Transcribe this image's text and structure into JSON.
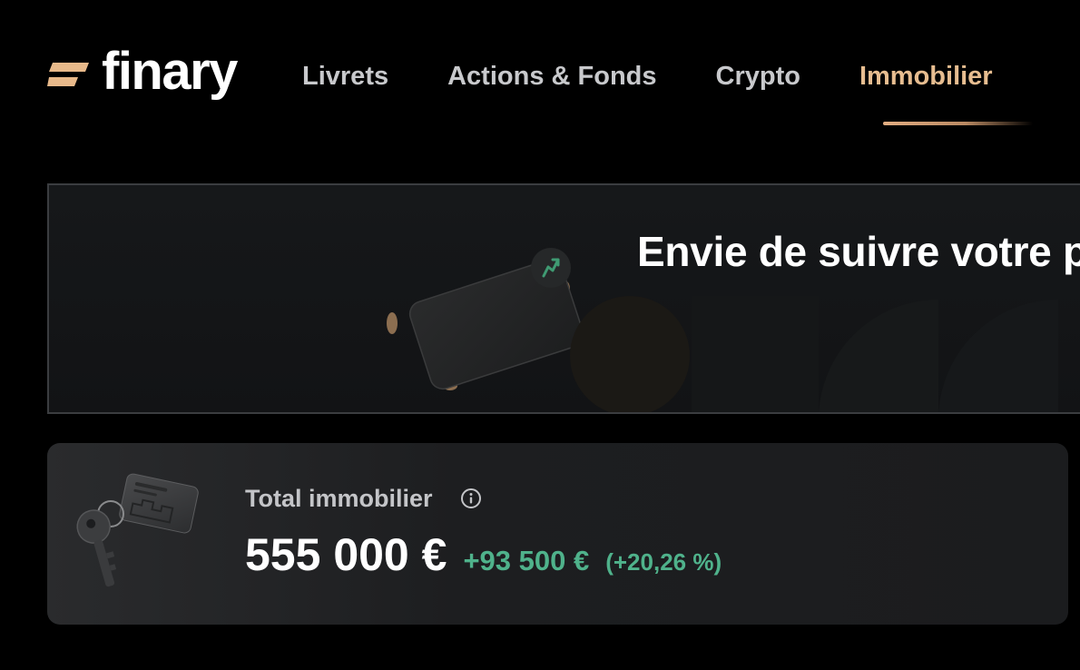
{
  "brand": {
    "name": "finary",
    "accent_color": "#e7bd90",
    "logo_mark_color": "#e8b98a"
  },
  "nav": {
    "tabs": [
      {
        "label": "Livrets",
        "active": false
      },
      {
        "label": "Actions & Fonds",
        "active": false
      },
      {
        "label": "Crypto",
        "active": false
      },
      {
        "label": "Immobilier",
        "active": true
      }
    ]
  },
  "banner": {
    "title": "Envie de suivre votre p",
    "icon": "growth-card-illustration"
  },
  "total": {
    "label": "Total immobilier",
    "info_icon": "info-icon",
    "value": "555 000 €",
    "delta": "+93 500 €",
    "delta_percent": "(+20,26 %)",
    "positive_color": "#4fb28b",
    "illustration": "keys-icon"
  }
}
